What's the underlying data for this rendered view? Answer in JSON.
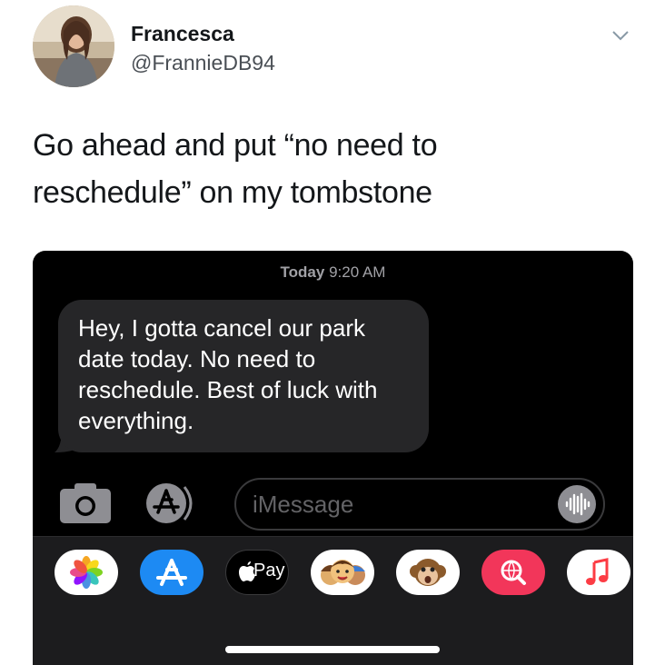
{
  "tweet": {
    "display_name": "Francesca",
    "handle": "@FrannieDB94",
    "text_line1": "Go ahead and put “no need to",
    "text_line2": "reschedule” on my tombstone"
  },
  "messages": {
    "timestamp_day": "Today",
    "timestamp_time": "9:20 AM",
    "bubble_lines": [
      "Hey, I gotta cancel our park",
      "date today. No need to",
      "reschedule. Best of luck with",
      "everything."
    ],
    "input_placeholder": "iMessage"
  },
  "app_tray": {
    "items": [
      {
        "name": "photos-icon"
      },
      {
        "name": "app-store-icon"
      },
      {
        "name": "apple-pay-icon",
        "label": "Pay"
      },
      {
        "name": "memoji-icon"
      },
      {
        "name": "animoji-monkey-icon"
      },
      {
        "name": "web-images-search-icon"
      },
      {
        "name": "music-icon"
      }
    ]
  },
  "colors": {
    "bubble": "#262628",
    "phone_background": "#000000",
    "tray_background": "#1c1c1e",
    "app_store_blue": "#1d8af3",
    "search_pink": "#f2365a"
  }
}
